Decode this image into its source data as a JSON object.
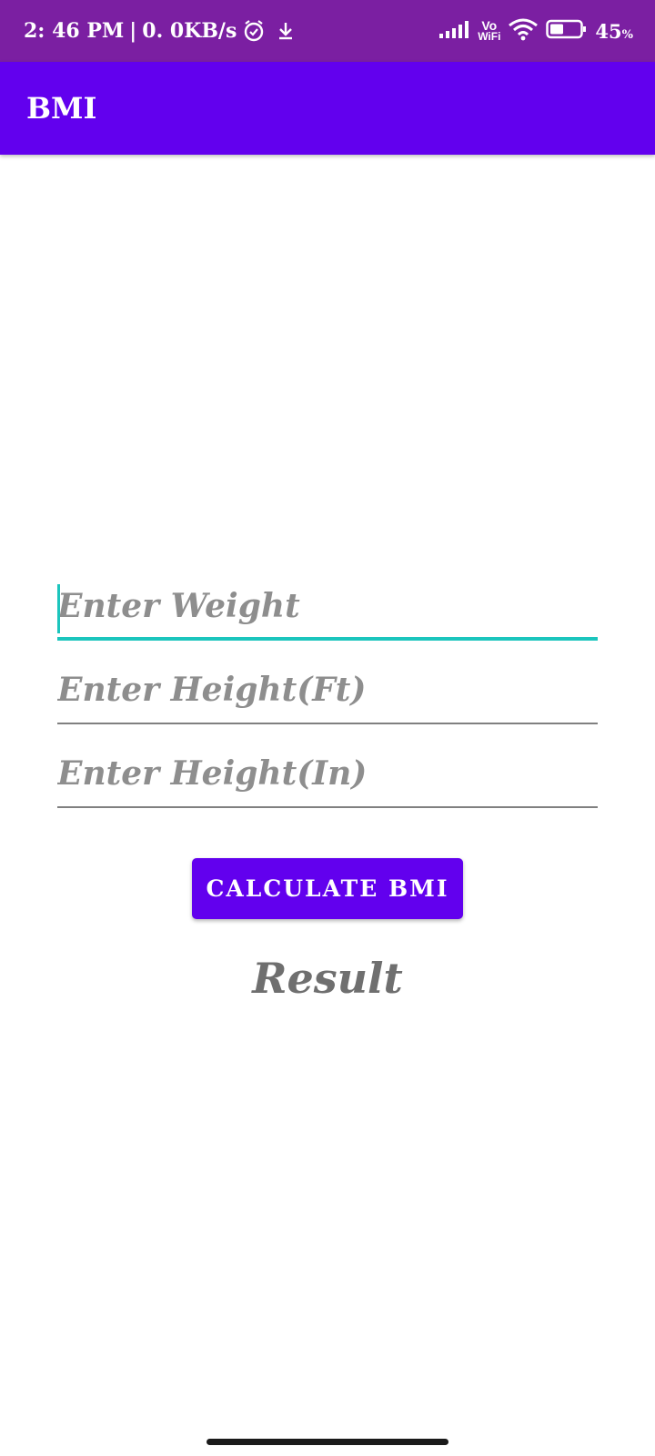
{
  "status_bar": {
    "time": "2: 46 PM",
    "separator": "|",
    "net_speed": "0. 0KB/s",
    "icons": [
      "alarm-icon",
      "download-icon",
      "signal-icon",
      "vowifi-icon",
      "wifi-icon",
      "battery-icon"
    ],
    "vowifi_top": "Vo",
    "vowifi_bottom": "WiFi",
    "battery_value": "45",
    "battery_unit": "%",
    "battery_level": 0.45,
    "bg_color": "#7B1FA2"
  },
  "app_bar": {
    "title": "BMI",
    "bg_color": "#6200EE"
  },
  "form": {
    "weight_placeholder": "Enter Weight",
    "weight_value": "",
    "height_ft_placeholder": "Enter Height(Ft)",
    "height_ft_value": "",
    "height_in_placeholder": "Enter Height(In)",
    "height_in_value": "",
    "focused_field": "weight",
    "accent_color": "#1BC5BD"
  },
  "calculate_button": {
    "label": "CALCULATE BMI",
    "color": "#6200EE"
  },
  "result": {
    "text": "Result"
  }
}
